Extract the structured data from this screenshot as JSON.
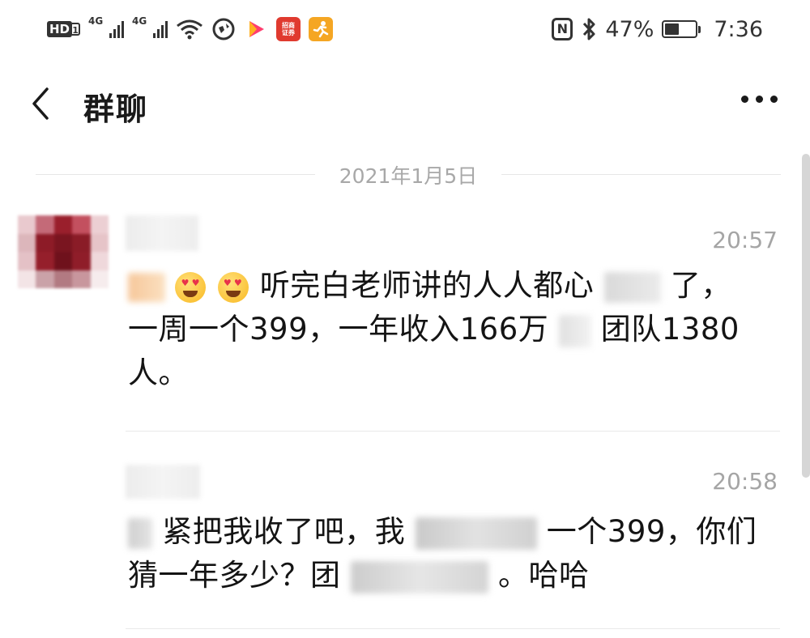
{
  "status_bar": {
    "hd_label": "HD",
    "hd_sub": "1",
    "signal_1_label": "4G",
    "signal_2_label": "4G",
    "app_icon_1_label": "招商证券",
    "battery_text": "47%",
    "time": "7:36",
    "nfc_label": "N",
    "colors": {
      "icon": "#333333",
      "app_icon_1": "#e03a2f",
      "app_icon_2": "#f5a623",
      "play_icon": "#ff3d6e"
    },
    "icons": [
      "hd-icon",
      "signal-icon",
      "signal-icon",
      "wifi-icon",
      "browser-icon",
      "video-play-icon",
      "zhaoshang-securities-icon",
      "running-man-app-icon",
      "nfc-icon",
      "bluetooth-icon",
      "battery-icon"
    ]
  },
  "nav": {
    "back_icon": "chevron-left-icon",
    "title": "群聊",
    "more_icon": "more-horizontal-icon"
  },
  "date_separator": "2021年1月5日",
  "messages": [
    {
      "time": "20:57",
      "text_line1_prefix": "听完白老师讲的人人都心",
      "text_line1_suffix": "了，",
      "text_line2_a": "一周一个399，一年收入166万",
      "text_line2_b": "团队1380",
      "text_line3": "人。"
    },
    {
      "time": "20:58",
      "text_line1_a": "紧把我收了吧，我",
      "text_line1_b": "一个399，你们",
      "text_line2_a": "猜一年多少？团",
      "text_line2_b": "。哈哈"
    }
  ]
}
